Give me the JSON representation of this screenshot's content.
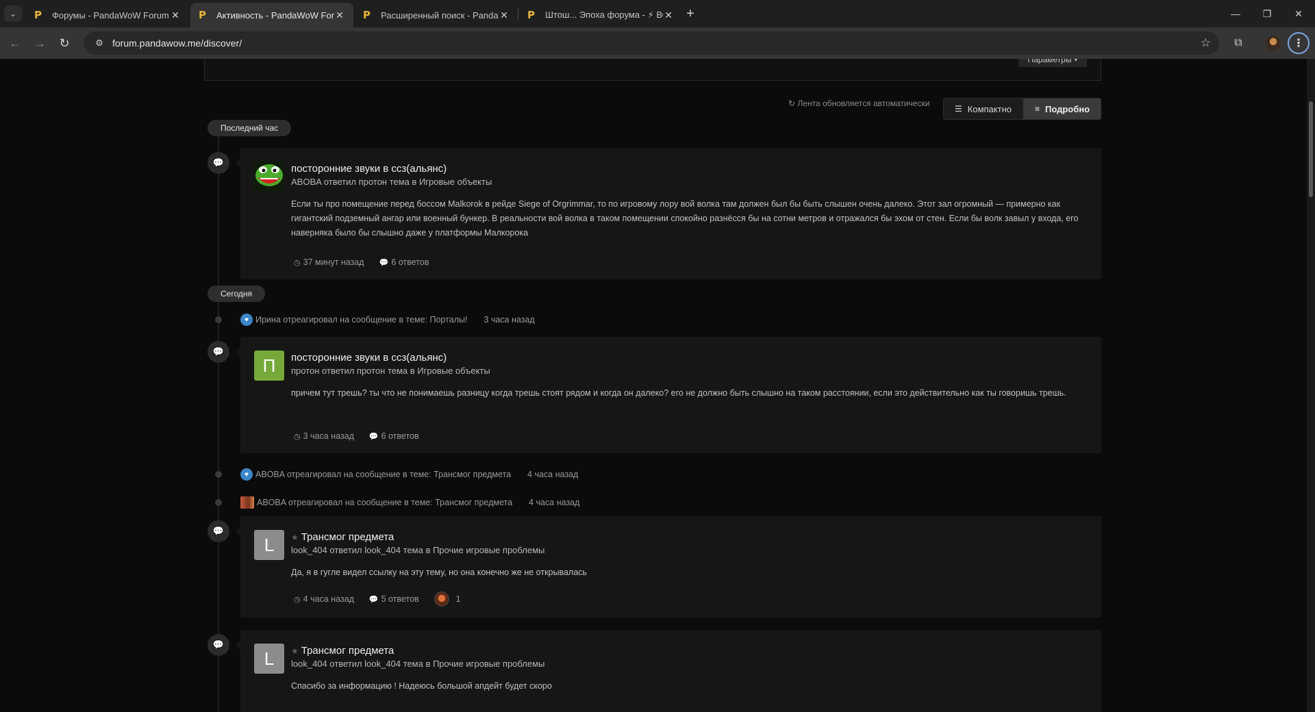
{
  "browser": {
    "tabs": [
      {
        "title": "Форумы - PandaWoW Forum",
        "active": false
      },
      {
        "title": "Активность - PandaWoW Forum",
        "active": true
      },
      {
        "title": "Расширенный поиск - PandaWoW Forum",
        "active": false
      },
      {
        "title": "Штош... Эпоха форума - ⚡ ВС",
        "active": false
      }
    ],
    "url": "forum.pandawow.me/discover/",
    "icons": {
      "tab_favicon": "P",
      "back": "←",
      "forward": "→",
      "reload": "↻",
      "star": "☆",
      "extensions": "puzzle-icon",
      "menu": "⋮"
    }
  },
  "page": {
    "params_label": "Параметры",
    "refresh_note": "Лента обновляется автоматически",
    "view_compact": "Компактно",
    "view_detailed": "Подробно",
    "periods": {
      "last_hour": "Последний час",
      "today": "Сегодня"
    },
    "items": [
      {
        "type": "post",
        "title": "посторонние звуки в ссз(альянс)",
        "subtitle": "ABOBA ответил протон тема в Игровые объекты",
        "body": "Если ты про помещение перед боссом Malkorok в рейде Siege of Orgrimmar, то по игровому лору вой волка там должен был бы быть слышен очень далеко. Этот зал огромный — примерно как гигантский подземный ангар или военный бункер. В реальности вой волка в таком помещении спокойно разнёсся бы на сотни метров и отражался бы эхом от стен. Если бы волк завыл у входа, его наверняка было бы слышно даже у платформы Малкорока",
        "time": "37 минут назад",
        "replies": "6 ответов"
      },
      {
        "type": "reaction",
        "text": "Ирина отреагировал на сообщение в теме: Порталы!",
        "time": "3 часа назад"
      },
      {
        "type": "post",
        "avatar_letter": "П",
        "title": "посторонние звуки в ссз(альянс)",
        "subtitle": "протон ответил протон тема в Игровые объекты",
        "body": "причем тут трешь? ты что не понимаешь разницу когда трешь стоят рядом и когда он далеко? его не должно быть слышно на таком расстоянии, если это действительно как ты говоришь трешь.",
        "time": "3 часа назад",
        "replies": "6 ответов"
      },
      {
        "type": "reaction",
        "text": "ABOBA отреагировал на сообщение в теме: Трансмог предмета",
        "time": "4 часа назад"
      },
      {
        "type": "reaction",
        "text": "ABOBA отреагировал на сообщение в теме: Трансмог предмета",
        "time": "4 часа назад"
      },
      {
        "type": "post",
        "avatar_letter": "L",
        "title": "Трансмог предмета",
        "subtitle": "look_404 ответил look_404 тема в Прочие игровые проблемы",
        "body": "Да, я в гугле видел ссылку на эту тему, но она конечно же не открывалась",
        "time": "4 часа назад",
        "replies": "5 ответов",
        "reactions": "1"
      },
      {
        "type": "post",
        "avatar_letter": "L",
        "title": "Трансмог предмета",
        "subtitle": "look_404 ответил look_404 тема в Прочие игровые проблемы",
        "body": "Спасибо за информацию ! Надеюсь большой апдейт будет скоро"
      }
    ]
  }
}
